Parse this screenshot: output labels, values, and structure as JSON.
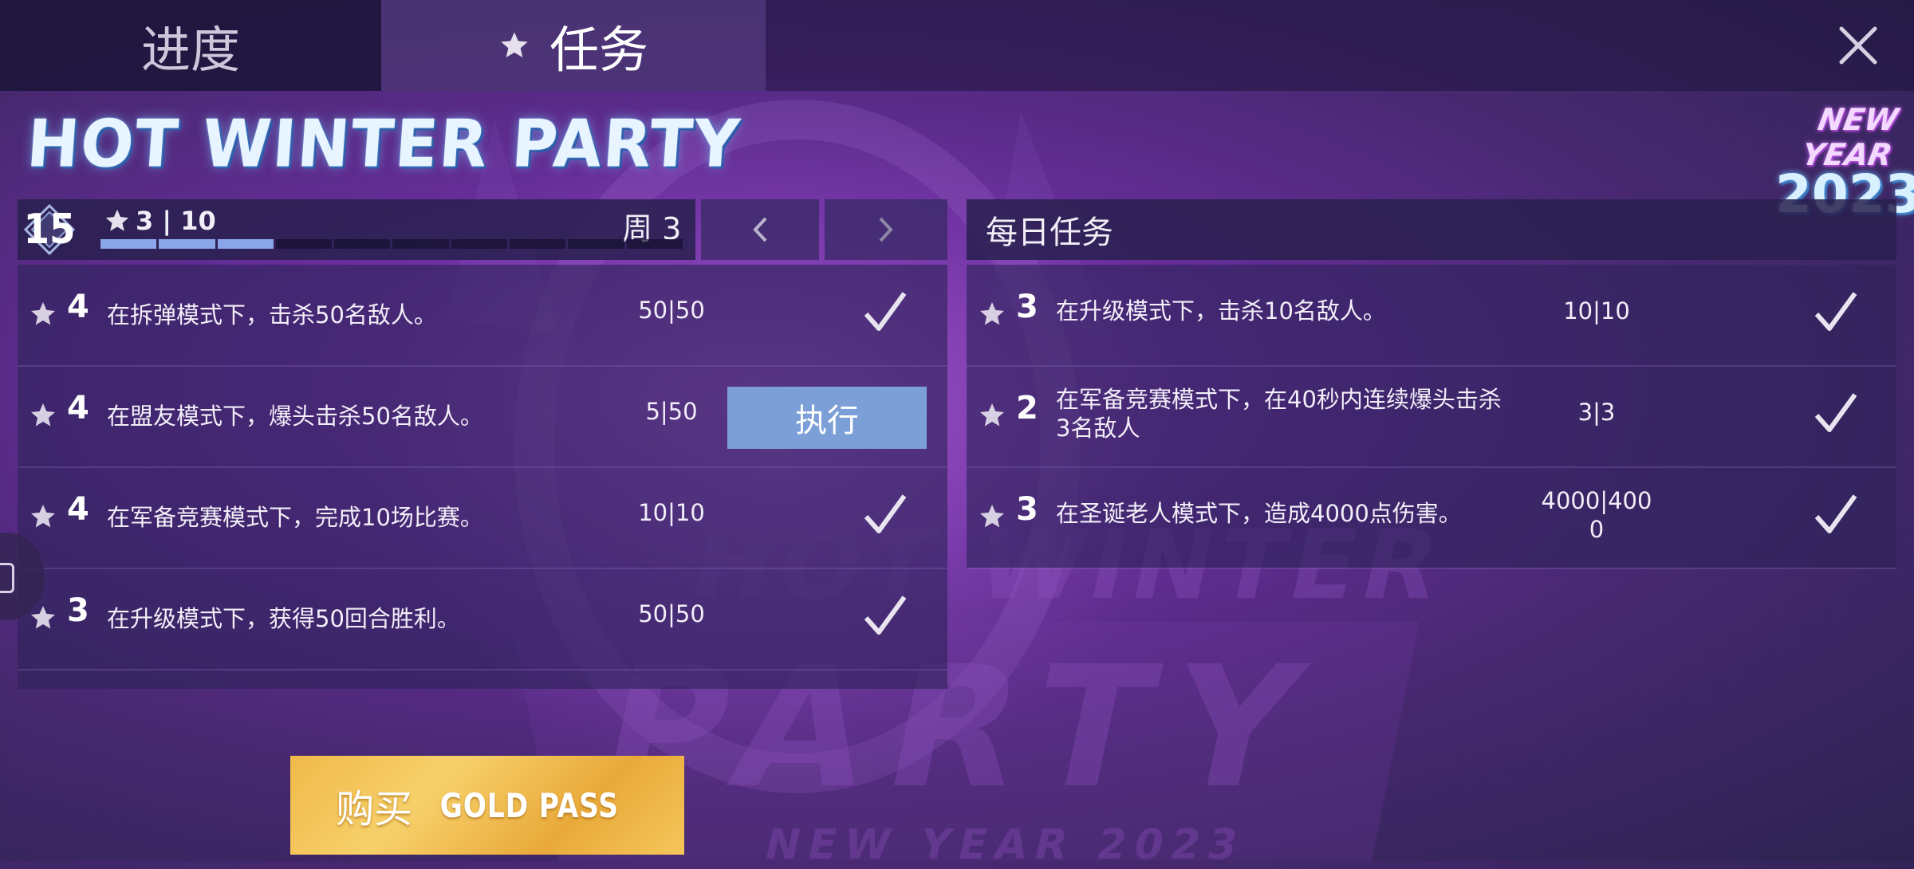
{
  "colors": {
    "accent_blue": "#7d9fd8",
    "progress_fill": "#8aa6e8",
    "gold_button": "#f0b94a",
    "panel_bg": "#2d2358"
  },
  "tabs": [
    {
      "label": "进度",
      "active": false
    },
    {
      "label": "任务",
      "active": true,
      "icon": "star-icon"
    }
  ],
  "event": {
    "title": "HOT WINTER PARTY",
    "logo_top": "NEW YEAR",
    "logo_year": "2023"
  },
  "weekly": {
    "level": "15",
    "stars": "3 | 10",
    "progress": 0.3,
    "segments_total": 10,
    "segments_filled": 3,
    "week": "周 3",
    "prev_icon": "chevron-left-icon",
    "next_icon": "chevron-right-icon",
    "tasks": [
      {
        "points": "4",
        "desc": "在拆弹模式下，击杀50名敌人。",
        "count": "50|50",
        "done": true
      },
      {
        "points": "4",
        "desc": "在盟友模式下，爆头击杀50名敌人。",
        "count": "5|50",
        "done": false,
        "action": "执行"
      },
      {
        "points": "4",
        "desc": "在军备竞赛模式下，完成10场比赛。",
        "count": "10|10",
        "done": true
      },
      {
        "points": "3",
        "desc": "在升级模式下，获得50回合胜利。",
        "count": "50|50",
        "done": true
      }
    ]
  },
  "daily": {
    "title": "每日任务",
    "tasks": [
      {
        "points": "3",
        "desc": "在升级模式下，击杀10名敌人。",
        "count": "10|10",
        "done": true
      },
      {
        "points": "2",
        "desc": "在军备竞赛模式下，在40秒内连续爆头击杀3名敌人",
        "count": "3|3",
        "done": true
      },
      {
        "points": "3",
        "desc": "在圣诞老人模式下，造成4000点伤害。",
        "count": "4000|4000",
        "done": true
      }
    ]
  },
  "buy_button": {
    "prefix": "购买",
    "product": "GOLD PASS"
  }
}
